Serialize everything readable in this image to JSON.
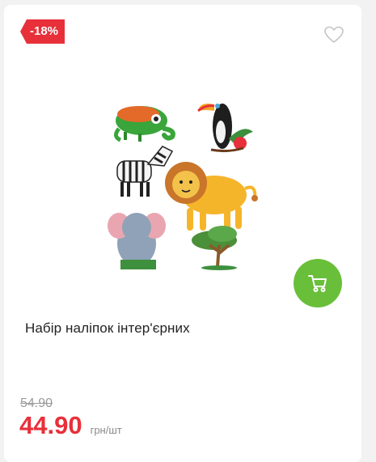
{
  "product": {
    "discount_badge": "-18%",
    "title": "Набір наліпок інтер'єрних",
    "old_price": "54.90",
    "price": "44.90",
    "unit": "грн/шт"
  },
  "icons": {
    "favorite": "heart-outline-icon",
    "cart": "shopping-cart-icon"
  },
  "colors": {
    "badge": "#e8303a",
    "price": "#e8303a",
    "cart_button": "#6abf3a"
  }
}
